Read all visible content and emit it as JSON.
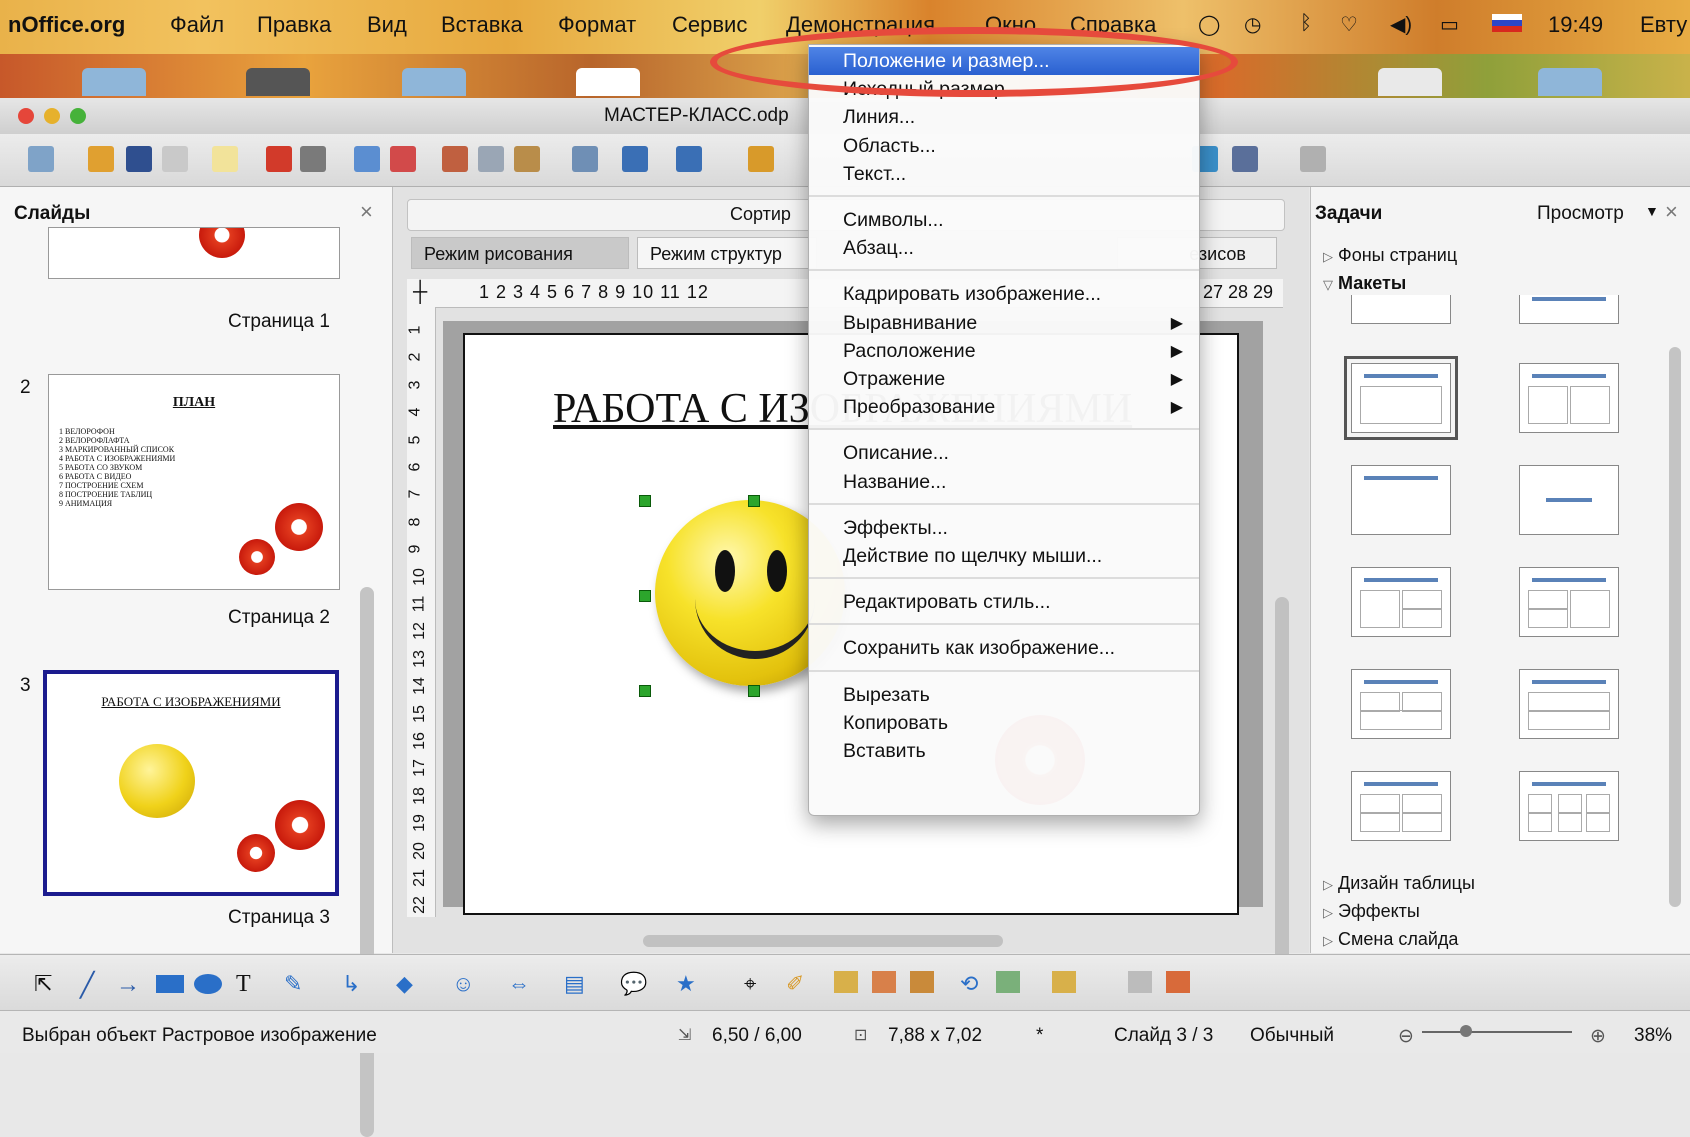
{
  "menubar": {
    "app_name": "nOffice.org",
    "items": [
      "Файл",
      "Правка",
      "Вид",
      "Вставка",
      "Формат",
      "Сервис",
      "Демонстрация",
      "Окно",
      "Справка"
    ],
    "clock": "19:49",
    "user": "Евту"
  },
  "window": {
    "title": "МАСТЕР-КЛАСС.odp"
  },
  "slides_pane": {
    "title": "Слайды",
    "slides": [
      {
        "number": "",
        "page_label": "Страница 1"
      },
      {
        "number": "2",
        "page_label": "Страница 2",
        "title": "ПЛАН",
        "lines": [
          "1 ВЕЛОРОФОН",
          "2 ВЕЛОРОФЛАФТА",
          "3 МАРКИРОВАННЫЙ СПИСОК",
          "4 РАБОТА С ИЗОБРАЖЕНИЯМИ",
          "5 РАБОТА СО ЗВУКОМ",
          "6 РАБОТА С ВИДЕО",
          "7 ПОСТРОЕНИЕ СХЕМ",
          "8 ПОСТРОЕНИЕ ТАБЛИЦ",
          "9 АНИМАЦИЯ"
        ]
      },
      {
        "number": "3",
        "page_label": "Страница 3",
        "title": "РАБОТА С ИЗОБРАЖЕНИЯМИ"
      }
    ]
  },
  "main": {
    "sorter_label": "Сортир",
    "tabs": [
      "Режим рисования",
      "Режим структур",
      "езисов"
    ],
    "ruler_left": "1 2 3 4 5 6 7 8 9 10 11 12",
    "ruler_right": "27 28 29",
    "vruler": [
      "1",
      "2",
      "3",
      "4",
      "5",
      "6",
      "7",
      "8",
      "9",
      "10",
      "11",
      "12",
      "13",
      "14",
      "15",
      "16",
      "17",
      "18",
      "19",
      "20",
      "21",
      "22"
    ],
    "slide_title": "РАБОТА С ИЗОБРАЖЕНИЯМИ"
  },
  "context_menu": {
    "groups": [
      [
        {
          "label": "Положение и размер...",
          "highlighted": true
        },
        {
          "label": "Исходный размер"
        },
        {
          "label": "Линия..."
        },
        {
          "label": "Область..."
        },
        {
          "label": "Текст..."
        }
      ],
      [
        {
          "label": "Символы..."
        },
        {
          "label": "Абзац..."
        }
      ],
      [
        {
          "label": "Кадрировать изображение..."
        },
        {
          "label": "Выравнивание",
          "submenu": true
        },
        {
          "label": "Расположение",
          "submenu": true
        },
        {
          "label": "Отражение",
          "submenu": true
        },
        {
          "label": "Преобразование",
          "submenu": true
        }
      ],
      [
        {
          "label": "Описание..."
        },
        {
          "label": "Название..."
        }
      ],
      [
        {
          "label": "Эффекты..."
        },
        {
          "label": "Действие по щелчку мыши..."
        }
      ],
      [
        {
          "label": "Редактировать стиль..."
        }
      ],
      [
        {
          "label": "Сохранить как изображение..."
        }
      ],
      [
        {
          "label": "Вырезать"
        },
        {
          "label": "Копировать"
        },
        {
          "label": "Вставить"
        }
      ]
    ],
    "submenu_arrow": "▶"
  },
  "tasks_pane": {
    "title": "Задачи",
    "view_label": "Просмотр",
    "sections": {
      "backgrounds": "Фоны страниц",
      "layouts": "Макеты",
      "table_design": "Дизайн таблицы",
      "effects": "Эффекты",
      "transition": "Смена слайда"
    }
  },
  "statusbar": {
    "selection": "Выбран объект Растровое изображение",
    "position": "6,50 / 6,00",
    "size": "7,88 x 7,02",
    "modified": "*",
    "slide": "Слайд 3 / 3",
    "layout": "Обычный",
    "zoom": "38%"
  },
  "colors": {
    "menu_highlight": "#2a60d0",
    "annotation_ring": "#e64a3c",
    "selection_handle": "#2ca52c",
    "selected_slide_border": "#1b1b8e"
  }
}
